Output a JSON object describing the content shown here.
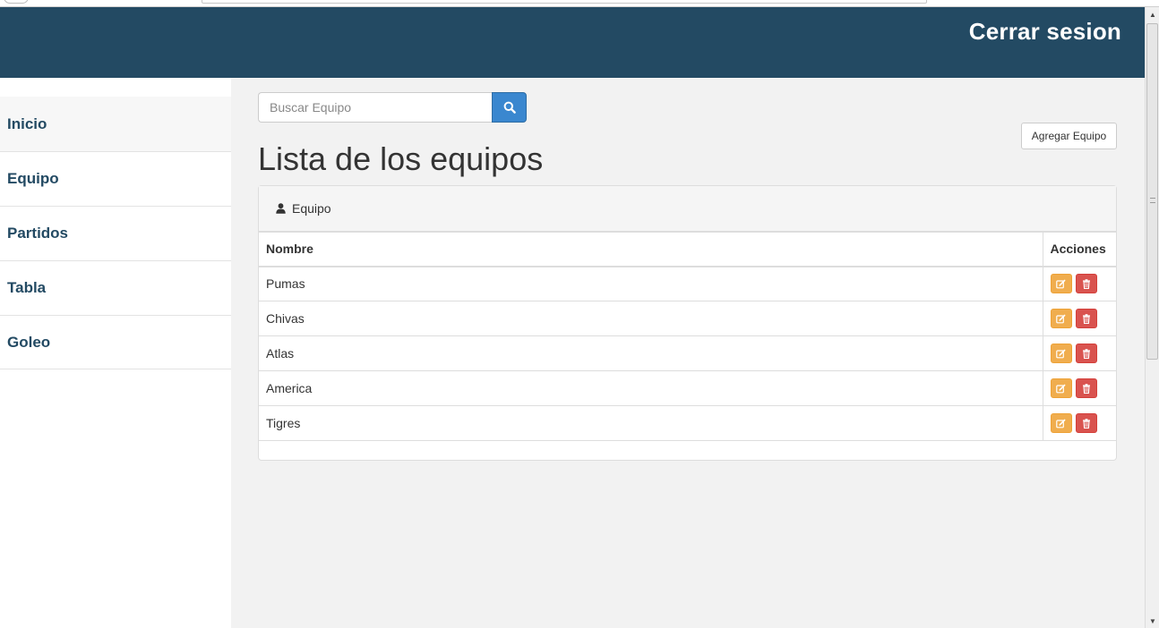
{
  "header": {
    "logout_label": "Cerrar sesion"
  },
  "sidebar": {
    "items": [
      {
        "label": "Inicio"
      },
      {
        "label": "Equipo"
      },
      {
        "label": "Partidos"
      },
      {
        "label": "Tabla"
      },
      {
        "label": "Goleo"
      }
    ]
  },
  "search": {
    "placeholder": "Buscar Equipo",
    "value": "",
    "icon": "search-icon"
  },
  "toolbar": {
    "add_label": "Agregar Equipo"
  },
  "page": {
    "title": "Lista de los equipos"
  },
  "panel": {
    "heading": "Equipo",
    "heading_icon": "user-icon",
    "columns": [
      "Nombre",
      "Acciones"
    ],
    "rows": [
      {
        "name": "Pumas"
      },
      {
        "name": "Chivas"
      },
      {
        "name": "Atlas"
      },
      {
        "name": "America"
      },
      {
        "name": "Tigres"
      }
    ],
    "row_actions": [
      "edit-icon",
      "trash-icon"
    ]
  },
  "colors": {
    "header_bg": "#234a63",
    "sidebar_text": "#234a63",
    "search_button": "#3a87cf",
    "edit_button": "#f0ad4e",
    "delete_button": "#d9534f",
    "content_bg": "#f2f2f2"
  }
}
